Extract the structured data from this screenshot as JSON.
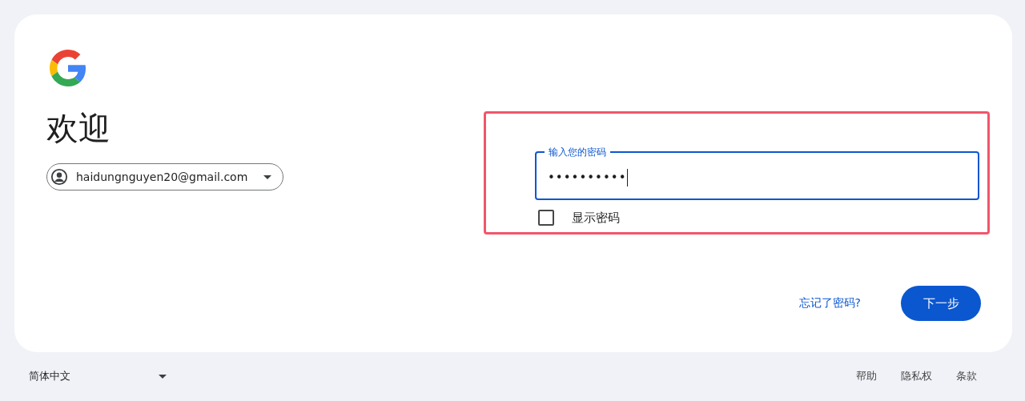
{
  "heading": "欢迎",
  "account": {
    "email": "haidungnguyen20@gmail.com"
  },
  "password_field": {
    "label": "输入您的密码",
    "value": "••••••••••",
    "focused": true
  },
  "show_password": {
    "label": "显示密码",
    "checked": false
  },
  "forgot_link": "忘记了密码?",
  "next_button": "下一步",
  "language": "简体中文",
  "footer_links": [
    "帮助",
    "隐私权",
    "条款"
  ]
}
